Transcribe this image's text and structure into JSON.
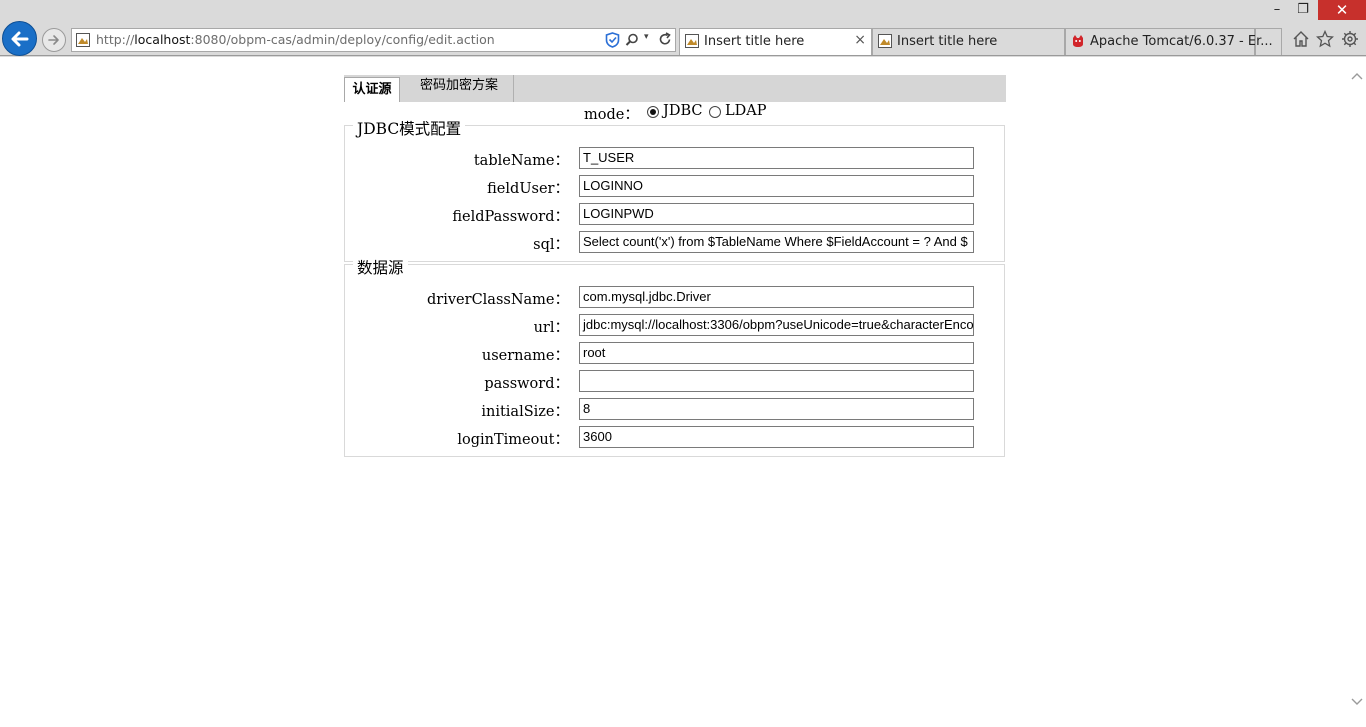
{
  "browser": {
    "url_prefix": "http://",
    "url_host": "localhost",
    "url_rest": ":8080/obpm-cas/admin/deploy/config/edit.action",
    "tabs": [
      {
        "label": "Insert title here",
        "close": "×"
      },
      {
        "label": "Insert title here"
      },
      {
        "label": "Apache Tomcat/6.0.37 - Er..."
      }
    ],
    "window_controls": {
      "minimize": "–",
      "restore": "❐",
      "close": "✕"
    },
    "dropdown_glyph": "▾"
  },
  "page_tabs": {
    "selected": "认证源",
    "other": "密码加密方案"
  },
  "mode": {
    "label": "mode：",
    "options": [
      {
        "label": "JDBC",
        "checked": true
      },
      {
        "label": "LDAP",
        "checked": false
      }
    ]
  },
  "jdbc_group": {
    "legend": "JDBC模式配置",
    "fields": [
      {
        "label": "tableName：",
        "value": "T_USER"
      },
      {
        "label": "fieldUser：",
        "value": "LOGINNO"
      },
      {
        "label": "fieldPassword：",
        "value": "LOGINPWD"
      },
      {
        "label": "sql：",
        "value": "Select count('x') from $TableName  Where $FieldAccount = ? And $"
      }
    ]
  },
  "datasource_group": {
    "legend": "数据源",
    "fields": [
      {
        "label": "driverClassName：",
        "value": "com.mysql.jdbc.Driver"
      },
      {
        "label": "url：",
        "value": "jdbc:mysql://localhost:3306/obpm?useUnicode=true&characterEnco"
      },
      {
        "label": "username：",
        "value": "root"
      },
      {
        "label": "password：",
        "value": ""
      },
      {
        "label": "initialSize：",
        "value": "8"
      },
      {
        "label": "loginTimeout：",
        "value": "3600"
      }
    ]
  }
}
